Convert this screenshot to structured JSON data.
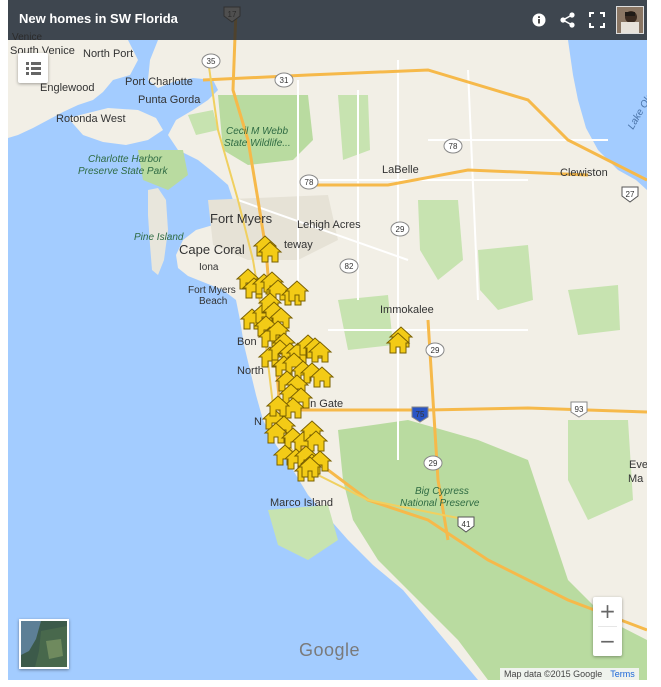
{
  "header": {
    "title": "New homes in SW Florida"
  },
  "controls": {
    "zoom_in_label": "+",
    "zoom_out_label": "−",
    "google_logo": "Google",
    "attribution": "Map data ©2015 Google",
    "terms_label": "Terms"
  },
  "icons": [
    "info-icon",
    "share-icon",
    "fullscreen-icon",
    "legend-list-icon",
    "home-marker-icon"
  ],
  "colors": {
    "water": "#a3ccff",
    "land": "#f2efe6",
    "park": "#b9dba0",
    "highway": "#f6b94a",
    "marker": "#f3cb16",
    "title_bar": "#2b2b2b"
  },
  "places": [
    {
      "id": "venice",
      "name": "South Venice"
    },
    {
      "id": "north_port",
      "name": "North Port"
    },
    {
      "id": "englewood",
      "name": "Englewood"
    },
    {
      "id": "port_charlotte",
      "name": "Port Charlotte"
    },
    {
      "id": "punta_gorda",
      "name": "Punta Gorda"
    },
    {
      "id": "rotonda",
      "name": "Rotonda West"
    },
    {
      "id": "fort_myers",
      "name": "Fort Myers"
    },
    {
      "id": "lehigh",
      "name": "Lehigh Acres"
    },
    {
      "id": "cape_coral",
      "name": "Cape Coral"
    },
    {
      "id": "iona",
      "name": "Iona"
    },
    {
      "id": "fm_beach_1",
      "name": "Fort Myers"
    },
    {
      "id": "fm_beach_2",
      "name": "Beach"
    },
    {
      "id": "gateway",
      "name": "teway"
    },
    {
      "id": "labelle",
      "name": "LaBelle"
    },
    {
      "id": "clewiston",
      "name": "Clewiston"
    },
    {
      "id": "immokalee",
      "name": "Immokalee"
    },
    {
      "id": "bonita",
      "name": "Bon"
    },
    {
      "id": "north_naples",
      "name": "North"
    },
    {
      "id": "golden_gate",
      "name": "en Gate"
    },
    {
      "id": "naples",
      "name": "N"
    },
    {
      "id": "marco",
      "name": "Marco Island"
    },
    {
      "id": "everglades",
      "name": "Eve"
    },
    {
      "id": "marl",
      "name": "Ma"
    }
  ],
  "parks": [
    {
      "id": "webb1",
      "name": "Cecil M Webb"
    },
    {
      "id": "webb2",
      "name": "State Wildlife..."
    },
    {
      "id": "charlotte1",
      "name": "Charlotte Harbor"
    },
    {
      "id": "charlotte2",
      "name": "Preserve State Park"
    },
    {
      "id": "pine_island",
      "name": "Pine Island"
    },
    {
      "id": "cypress1",
      "name": "Big Cypress"
    },
    {
      "id": "cypress2",
      "name": "National Preserve"
    }
  ],
  "water_labels": [
    {
      "id": "okeechobee",
      "name": "Lake Okeechobee"
    },
    {
      "id": "venice_top",
      "name": "Venice"
    }
  ],
  "road_shields": [
    {
      "id": "r17",
      "label": "17"
    },
    {
      "id": "r35",
      "label": "35"
    },
    {
      "id": "r31",
      "label": "31"
    },
    {
      "id": "r78a",
      "label": "78"
    },
    {
      "id": "r78b",
      "label": "78"
    },
    {
      "id": "r29a",
      "label": "29"
    },
    {
      "id": "r82",
      "label": "82"
    },
    {
      "id": "r29b",
      "label": "29"
    },
    {
      "id": "r29c",
      "label": "29"
    },
    {
      "id": "r93",
      "label": "93"
    },
    {
      "id": "r75",
      "label": "75"
    },
    {
      "id": "r41",
      "label": "41"
    },
    {
      "id": "r27",
      "label": "27"
    }
  ],
  "home_markers_count": 52
}
